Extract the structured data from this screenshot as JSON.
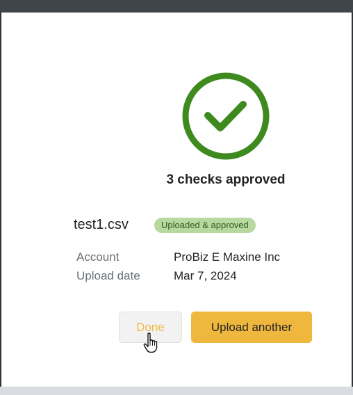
{
  "result": {
    "headline": "3 checks approved"
  },
  "file": {
    "name": "test1.csv",
    "status": "Uploaded & approved"
  },
  "details": {
    "account_label": "Account",
    "account_value": "ProBiz E Maxine Inc",
    "date_label": "Upload date",
    "date_value": "Mar 7, 2024"
  },
  "actions": {
    "done_label": "Done",
    "upload_label": "Upload another"
  },
  "colors": {
    "success_green": "#3f8a1f",
    "badge_bg": "#b7d99f",
    "accent_yellow": "#f0b73e",
    "top_bar": "#3f4549"
  },
  "icons": {
    "success": "check-circle-icon",
    "cursor": "hand-pointer-icon"
  }
}
